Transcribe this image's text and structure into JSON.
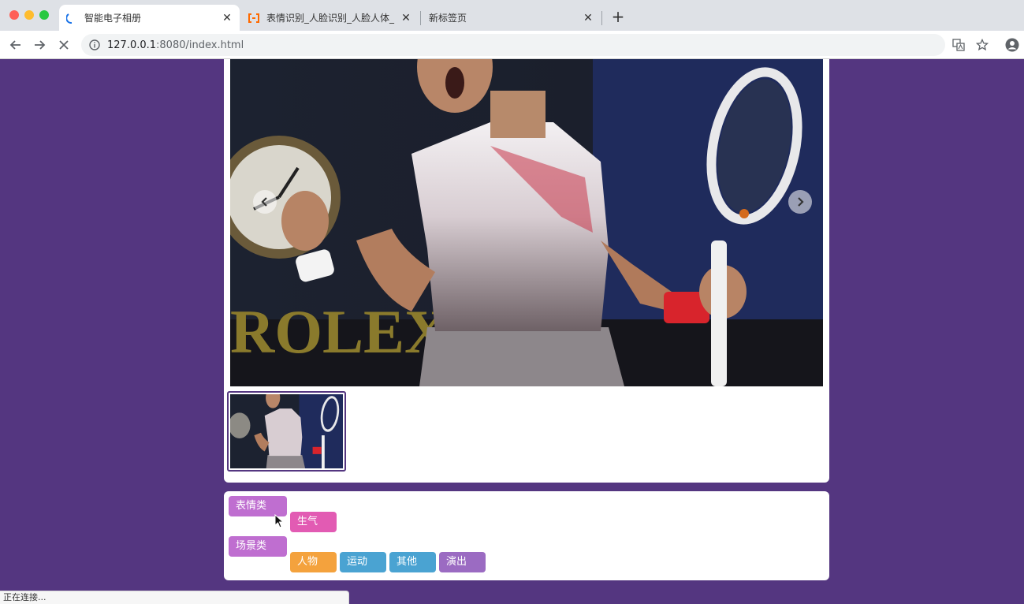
{
  "browser": {
    "tabs": [
      {
        "title": "智能电子相册",
        "active": true
      },
      {
        "title": "表情识别_人脸识别_人脸人体_",
        "active": false
      },
      {
        "title": "新标签页",
        "active": false
      }
    ],
    "address": {
      "host": "127.0.0.1",
      "path": ":8080/index.html"
    },
    "status_text": "正在连接..."
  },
  "colors": {
    "page_bg": "#543680",
    "tag_category": "#bf6ed0",
    "tag_pink": "#e25bb3",
    "tag_orange": "#f4a23d",
    "tag_blue": "#4aa3d2",
    "tag_purple": "#9b6bc2"
  },
  "gallery": {
    "prev_icon": "chevron-left-icon",
    "next_icon": "chevron-right-icon",
    "photo_text": "ROLEX"
  },
  "tags": {
    "groups": [
      {
        "category": "表情类",
        "items": [
          "生气"
        ]
      },
      {
        "category": "场景类",
        "items": [
          "人物",
          "运动",
          "其他",
          "演出"
        ]
      }
    ]
  }
}
